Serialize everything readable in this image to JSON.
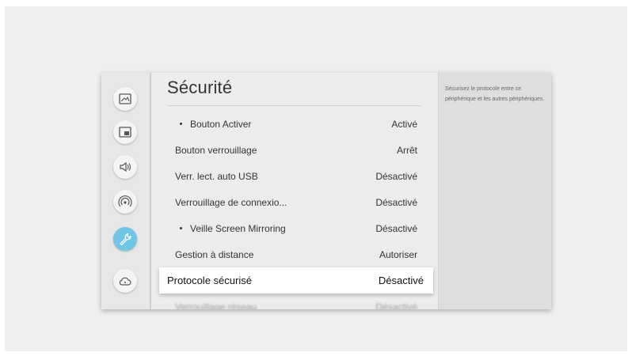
{
  "section_title": "Sécurité",
  "sidebar": {
    "items": [
      {
        "icon": "picture-icon",
        "active": false
      },
      {
        "icon": "picture-in-picture-icon",
        "active": false
      },
      {
        "icon": "sound-icon",
        "active": false
      },
      {
        "icon": "network-icon",
        "active": false
      },
      {
        "icon": "wrench-icon",
        "active": true
      },
      {
        "icon": "cloud-support-icon",
        "active": false
      }
    ]
  },
  "settings": [
    {
      "label": "Bouton Activer",
      "value": "Activé",
      "sub": true
    },
    {
      "label": "Bouton verrouillage",
      "value": "Arrêt",
      "sub": false
    },
    {
      "label": "Verr. lect. auto USB",
      "value": "Désactivé",
      "sub": false
    },
    {
      "label": "Verrouillage de connexio...",
      "value": "Désactivé",
      "sub": false
    },
    {
      "label": "Veille Screen Mirroring",
      "value": "Désactivé",
      "sub": true
    },
    {
      "label": "Gestion à distance",
      "value": "Autoriser",
      "sub": false
    },
    {
      "label": "Protocole sécurisé",
      "value": "Désactivé",
      "sub": false,
      "selected": true
    },
    {
      "label": "Verrouillage réseau",
      "value": "Désactivé",
      "sub": false
    }
  ],
  "help": {
    "text": "Sécurisez le protocole entre ce périphérique et les autres périphériques."
  },
  "colors": {
    "accent": "#6fc6e6",
    "background": "#efefef",
    "panel": "#e6e6e6"
  }
}
